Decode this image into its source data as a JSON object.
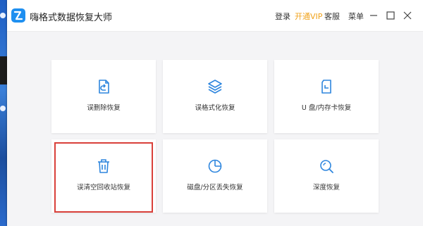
{
  "app": {
    "title": "嗨格式数据恢复大师",
    "brand_color": "#1e8ff0"
  },
  "header": {
    "menu": [
      {
        "label": "登录"
      },
      {
        "label": "开通VIP",
        "color": "#f0a21a"
      },
      {
        "label": "客服"
      },
      {
        "label": "菜单"
      }
    ],
    "window_controls": [
      "minimize-icon",
      "maximize-icon",
      "close-icon"
    ]
  },
  "cards": [
    {
      "label": "误删除恢复",
      "icon": "restore-file-icon"
    },
    {
      "label": "误格式化恢复",
      "icon": "layers-icon"
    },
    {
      "label": "U 盘/内存卡恢复",
      "icon": "sd-card-icon"
    },
    {
      "label": "误清空回收站恢复",
      "icon": "trash-icon",
      "highlighted": true
    },
    {
      "label": "磁盘/分区丢失恢复",
      "icon": "pie-chart-icon"
    },
    {
      "label": "深度恢复",
      "icon": "magnifier-icon"
    }
  ],
  "highlight_color": "#d9403a",
  "icon_color": "#2e86de"
}
